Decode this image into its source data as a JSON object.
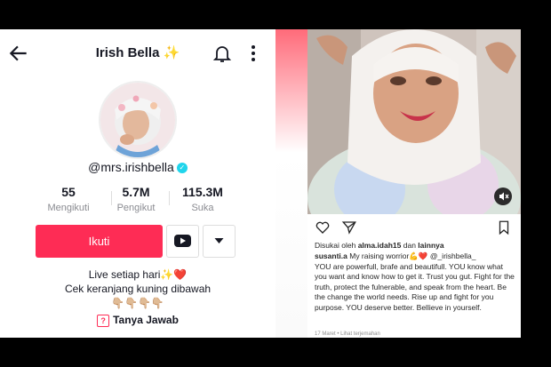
{
  "profile": {
    "title": "Irish Bella ✨",
    "handle": "@mrs.irishbella",
    "stats": [
      {
        "value": "55",
        "label": "Mengikuti"
      },
      {
        "value": "5.7M",
        "label": "Pengikut"
      },
      {
        "value": "115.3M",
        "label": "Suka"
      }
    ],
    "follow_label": "Ikuti",
    "bio_line1": "Live setiap hari✨❤️",
    "bio_line2": "Cek keranjang kuning dibawah",
    "bio_line3": "👇🏼👇🏼👇🏼👇🏼",
    "qa_label": "Tanya Jawab"
  },
  "post": {
    "liked_prefix": "Disukai oleh",
    "liked_user": "alma.idah15",
    "liked_mid": "dan",
    "liked_suffix": "lainnya",
    "caption_user": "susanti.a",
    "caption_text": "My raising worrior💪❤️ @_irishbella_",
    "caption_body": "YOU are powerfull, brafe and beautifull. YOU know what you want and know how to get it. Trust you gut. Fight for the truth, protect the  fulnerable, and speak from the heart. Be the change the world needs. Rise up and fight for you purpose. YOU deserve better. Bellieve in yourself.",
    "date": "17 Maret",
    "translate": "Lihat terjemahan"
  },
  "icons": {
    "back": "arrow-left-icon",
    "bell": "bell-icon",
    "more": "more-vertical-icon",
    "youtube": "youtube-icon",
    "dropdown": "caret-down-icon",
    "qa": "question-icon",
    "heart": "heart-icon",
    "send": "send-icon",
    "bookmark": "bookmark-icon",
    "mute": "mute-icon"
  },
  "colors": {
    "accent": "#fe2c55",
    "verified": "#20d5ec"
  }
}
